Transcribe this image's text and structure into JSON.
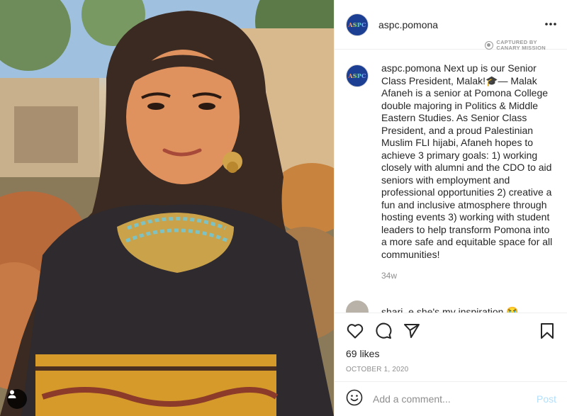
{
  "post": {
    "username": "aspc.pomona",
    "avatar_text": "ASPC",
    "caption": "Next up is our Senior Class President, Malak!🎓— Malak Afaneh is a senior at Pomona College double majoring in Politics & Middle Eastern Studies. As Senior Class President, and a proud Palestinian Muslim FLI hijabi, Afaneh hopes to achieve 3 primary goals: 1) working closely with alumni and the CDO to aid seniors with employment and professional opportunities 2) creative a fun and inclusive atmosphere through hosting events 3) working with student leaders to help transform Pomona into a more safe and equitable space for all communities!",
    "time_ago": "34w",
    "likes": "69 likes",
    "date": "OCTOBER 1, 2020"
  },
  "watermark": {
    "line1": "CAPTURED BY",
    "line2": "CANARY MISSION"
  },
  "comment": {
    "username": "shari_e",
    "text": "she's my inspiration 😭"
  },
  "comment_box": {
    "placeholder": "Add a comment...",
    "post_label": "Post"
  },
  "icons": {
    "more": "more-horizontal-icon",
    "like": "heart-icon",
    "comment": "comment-icon",
    "share": "send-icon",
    "save": "bookmark-icon",
    "emoji": "emoji-icon",
    "user_tag": "user-tag-icon"
  },
  "colors": {
    "link_disabled": "#b2dffc",
    "muted": "#8e8e8e",
    "avatar_bg": "#1c3f94"
  }
}
